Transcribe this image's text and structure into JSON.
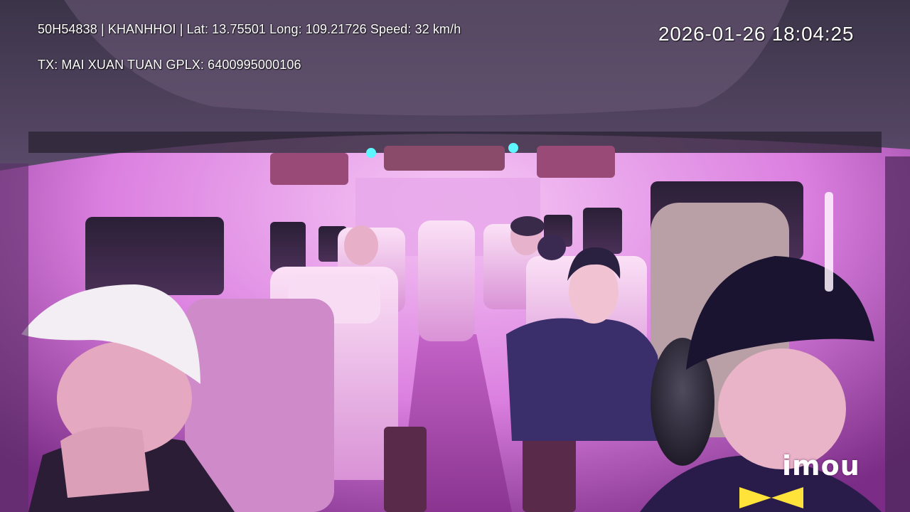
{
  "overlay": {
    "line1": "50H54838 | KHANHHOI | Lat: 13.75501 Long: 109.21726 Speed: 32 km/h",
    "line2": "TX: MAI XUAN TUAN GPLX: 6400995000106",
    "timestamp": "2026-01-26 18:04:25",
    "logo": "imou"
  },
  "colors": {
    "cabin_light": "#e18be8",
    "ceiling": "#4a3a5a",
    "seat": "#f1c4ea",
    "accent": "#ff4fe0"
  }
}
